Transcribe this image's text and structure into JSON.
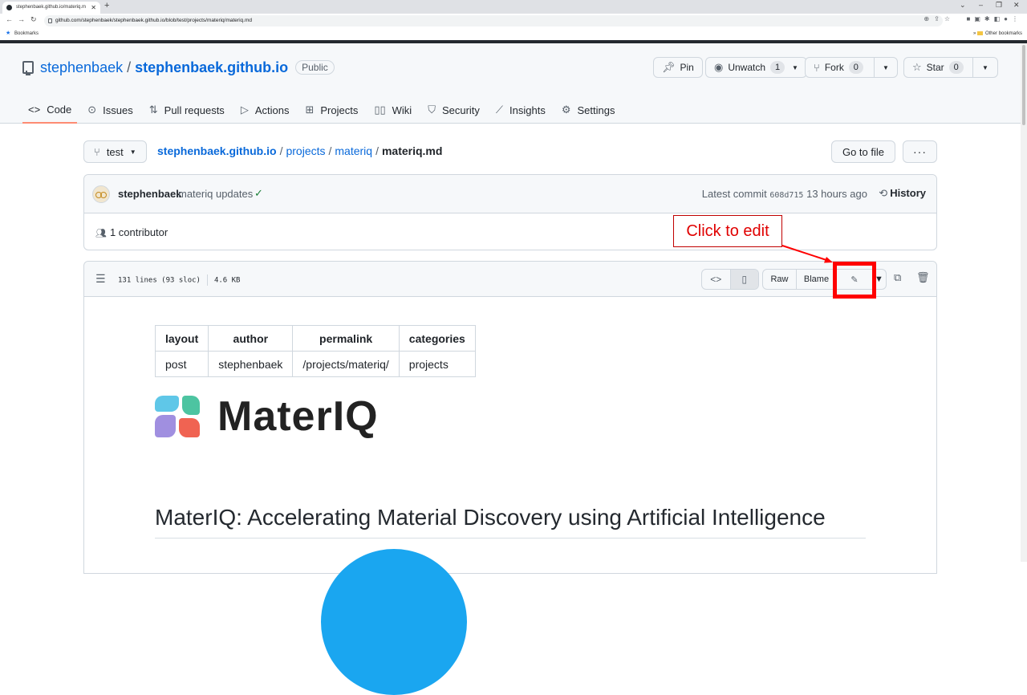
{
  "browser": {
    "tab_title": "stephenbaek.github.io/materiq.m",
    "url": "github.com/stephenbaek/stephenbaek.github.io/blob/test/projects/materiq/materiq.md",
    "bookmarks_label": "Bookmarks",
    "other_bookmarks": "Other bookmarks"
  },
  "repo": {
    "owner": "stephenbaek",
    "separator": "/",
    "name": "stephenbaek.github.io",
    "visibility": "Public",
    "pin_label": "Pin",
    "unwatch_label": "Unwatch",
    "unwatch_count": "1",
    "fork_label": "Fork",
    "fork_count": "0",
    "star_label": "Star",
    "star_count": "0"
  },
  "nav": {
    "code": "Code",
    "issues": "Issues",
    "pulls": "Pull requests",
    "actions": "Actions",
    "projects": "Projects",
    "wiki": "Wiki",
    "security": "Security",
    "insights": "Insights",
    "settings": "Settings"
  },
  "file": {
    "branch": "test",
    "crumb_repo": "stephenbaek.github.io",
    "crumb_1": "projects",
    "crumb_2": "materiq",
    "filename": "materiq.md",
    "go_to_file": "Go to file",
    "more": "···"
  },
  "commit": {
    "author": "stephenbaek",
    "message": "materiq updates",
    "latest_prefix": "Latest commit",
    "sha": "608d715",
    "age": "13 hours ago",
    "history": "History",
    "contributors": "1 contributor"
  },
  "filebar": {
    "lines": "131 lines (93 sloc)",
    "size": "4.6 KB",
    "raw": "Raw",
    "blame": "Blame"
  },
  "annotation": {
    "label": "Click to edit",
    "color": "#ff0000"
  },
  "markdown": {
    "table_headers": [
      "layout",
      "author",
      "permalink",
      "categories"
    ],
    "table_row": [
      "post",
      "stephenbaek",
      "/projects/materiq/",
      "projects"
    ],
    "logo_text": "MaterIQ",
    "heading": "MaterIQ: Accelerating Material Discovery using Artificial Intelligence"
  }
}
